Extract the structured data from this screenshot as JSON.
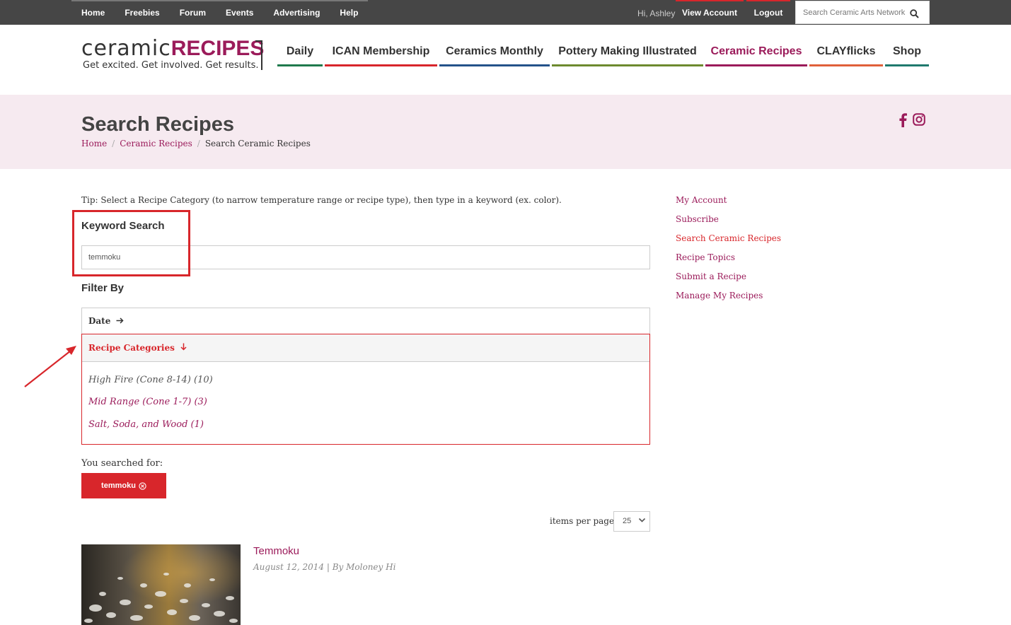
{
  "top_nav": {
    "items": [
      "Home",
      "Freebies",
      "Forum",
      "Events",
      "Advertising",
      "Help"
    ],
    "greeting": "Hi, Ashley",
    "view_account": "View Account",
    "logout": "Logout",
    "search_placeholder": "Search Ceramic Arts Network"
  },
  "logo": {
    "word_part1": "ceramic",
    "word_part2": "RECIPES",
    "tagline": "Get excited. Get involved. Get results."
  },
  "main_nav": {
    "items": [
      {
        "label": "Daily",
        "color": "#1f7a4d"
      },
      {
        "label": "ICAN Membership",
        "color": "#d8262b"
      },
      {
        "label": "Ceramics Monthly",
        "color": "#24528a"
      },
      {
        "label": "Pottery Making Illustrated",
        "color": "#6d8a2f"
      },
      {
        "label": "Ceramic Recipes",
        "color": "#9b1b5a",
        "active": true
      },
      {
        "label": "CLAYflicks",
        "color": "#e0603a"
      },
      {
        "label": "Shop",
        "color": "#1f7a6e"
      }
    ]
  },
  "page": {
    "title": "Search Recipes",
    "breadcrumb": [
      "Home",
      "Ceramic Recipes",
      "Search Ceramic Recipes"
    ]
  },
  "tip": "Tip: Select a Recipe Category (to narrow temperature range or recipe type), then type in a keyword (ex. color).",
  "keyword_search": {
    "label": "Keyword Search",
    "value": "temmoku"
  },
  "filter": {
    "label": "Filter By",
    "date_label": "Date",
    "categories_label": "Recipe Categories",
    "categories": [
      {
        "label": "High Fire (Cone 8-14) (10)",
        "color": "#555555"
      },
      {
        "label": "Mid Range (Cone 1-7) (3)",
        "color": "#9b1b5a"
      },
      {
        "label": "Salt, Soda, and Wood (1)",
        "color": "#9b1b5a"
      }
    ]
  },
  "searched_for": {
    "label": "You searched for:",
    "term": "temmoku"
  },
  "items_per_page": {
    "label": "items per page",
    "value": "25"
  },
  "result": {
    "title": "Temmoku",
    "meta": "August 12, 2014 | By Moloney Hi"
  },
  "sidebar": {
    "links": [
      {
        "label": "My Account",
        "color": "#9b1b5a"
      },
      {
        "label": "Subscribe",
        "color": "#9b1b5a"
      },
      {
        "label": "Search Ceramic Recipes",
        "color": "#d8262b"
      },
      {
        "label": "Recipe Topics",
        "color": "#9b1b5a"
      },
      {
        "label": "Submit a Recipe",
        "color": "#9b1b5a"
      },
      {
        "label": "Manage My Recipes",
        "color": "#9b1b5a"
      }
    ]
  },
  "colors": {
    "accent_red": "#d8262b",
    "brand_magenta": "#9b1b5a",
    "banner_pink": "#f6eaf0",
    "topbar": "#464646"
  }
}
